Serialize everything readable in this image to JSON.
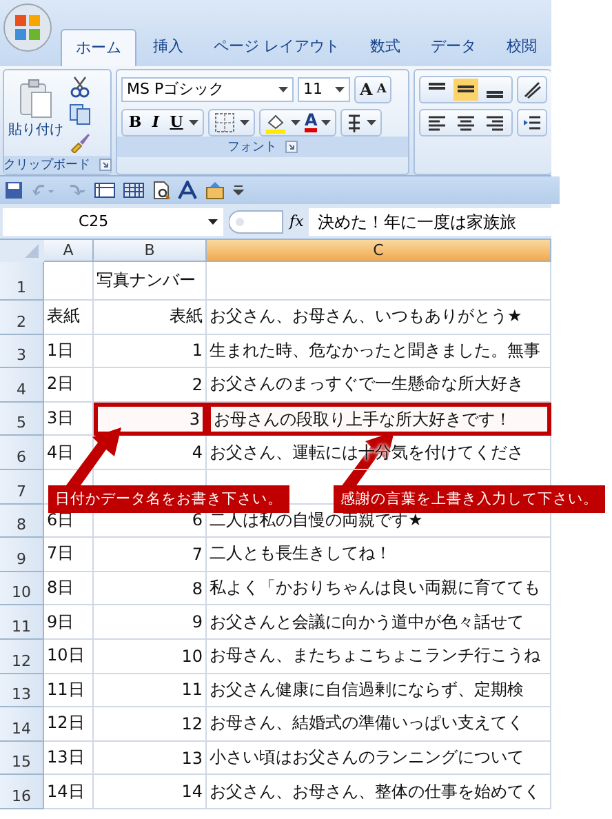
{
  "tabs": [
    {
      "label": "ホーム",
      "selected": true
    },
    {
      "label": "挿入",
      "selected": false
    },
    {
      "label": "ページ レイアウト",
      "selected": false
    },
    {
      "label": "数式",
      "selected": false
    },
    {
      "label": "データ",
      "selected": false
    },
    {
      "label": "校閲",
      "selected": false
    }
  ],
  "clipboard": {
    "paste_label": "貼り付け",
    "group_label": "クリップボード"
  },
  "font": {
    "font_name": "MS Pゴシック",
    "font_size": "11",
    "group_label": "フォント",
    "size_buttons": [
      "A",
      "A"
    ],
    "style_buttons": [
      "B",
      "I",
      "U"
    ],
    "color_button": "A"
  },
  "name_box": "C25",
  "function_label": "fx",
  "formula": "決めた！年に一度は家族旅",
  "columns": [
    {
      "label": "A",
      "selected": false
    },
    {
      "label": "B",
      "selected": false
    },
    {
      "label": "C",
      "selected": true
    }
  ],
  "rows": [
    {
      "number": "1",
      "b": "写真ナンバー",
      "highlighted": false
    },
    {
      "number": "2",
      "a": "表紙",
      "b": "表紙",
      "c": "お父さん、お母さん、いつもありがとう★",
      "highlighted": false
    },
    {
      "number": "3",
      "a": "1日",
      "b": "1",
      "c": "生まれた時、危なかったと聞きました。無事",
      "highlighted": false
    },
    {
      "number": "4",
      "a": "2日",
      "b": "2",
      "c": "お父さんのまっすぐで一生懸命な所大好き",
      "highlighted": false
    },
    {
      "number": "5",
      "a": "3日",
      "b": "3",
      "c": "お母さんの段取り上手な所大好きです！",
      "highlighted": true
    },
    {
      "number": "6",
      "a": "4日",
      "b": "4",
      "c": "お父さん、運転には十分気を付けてくださ",
      "highlighted": false
    },
    {
      "number": "7",
      "highlighted": false
    },
    {
      "number": "8",
      "a": "6日",
      "b": "6",
      "c": "二人は私の自慢の両親です★",
      "highlighted": false
    },
    {
      "number": "9",
      "a": "7日",
      "b": "7",
      "c": "二人とも長生きしてね！",
      "highlighted": false
    },
    {
      "number": "10",
      "a": "8日",
      "b": "8",
      "c": "私よく「かおりちゃんは良い両親に育てても",
      "highlighted": false
    },
    {
      "number": "11",
      "a": "9日",
      "b": "9",
      "c": "お父さんと会議に向かう道中が色々話せて",
      "highlighted": false
    },
    {
      "number": "12",
      "a": "10日",
      "b": "10",
      "c": "お母さん、またちょこちょこランチ行こうね",
      "highlighted": false
    },
    {
      "number": "13",
      "a": "11日",
      "b": "11",
      "c": "お父さん健康に自信過剰にならず、定期検",
      "highlighted": false
    },
    {
      "number": "14",
      "a": "12日",
      "b": "12",
      "c": "お母さん、結婚式の準備いっぱい支えてく",
      "highlighted": false
    },
    {
      "number": "15",
      "a": "13日",
      "b": "13",
      "c": "小さい頃はお父さんのランニングについて",
      "highlighted": false
    },
    {
      "number": "16",
      "a": "14日",
      "b": "14",
      "c": "お父さん、お母さん、整体の仕事を始めてく",
      "highlighted": false
    }
  ],
  "callouts": [
    "日付かデータ名をお書き下さい。",
    "感謝の言葉を上書き入力して下さい。"
  ]
}
